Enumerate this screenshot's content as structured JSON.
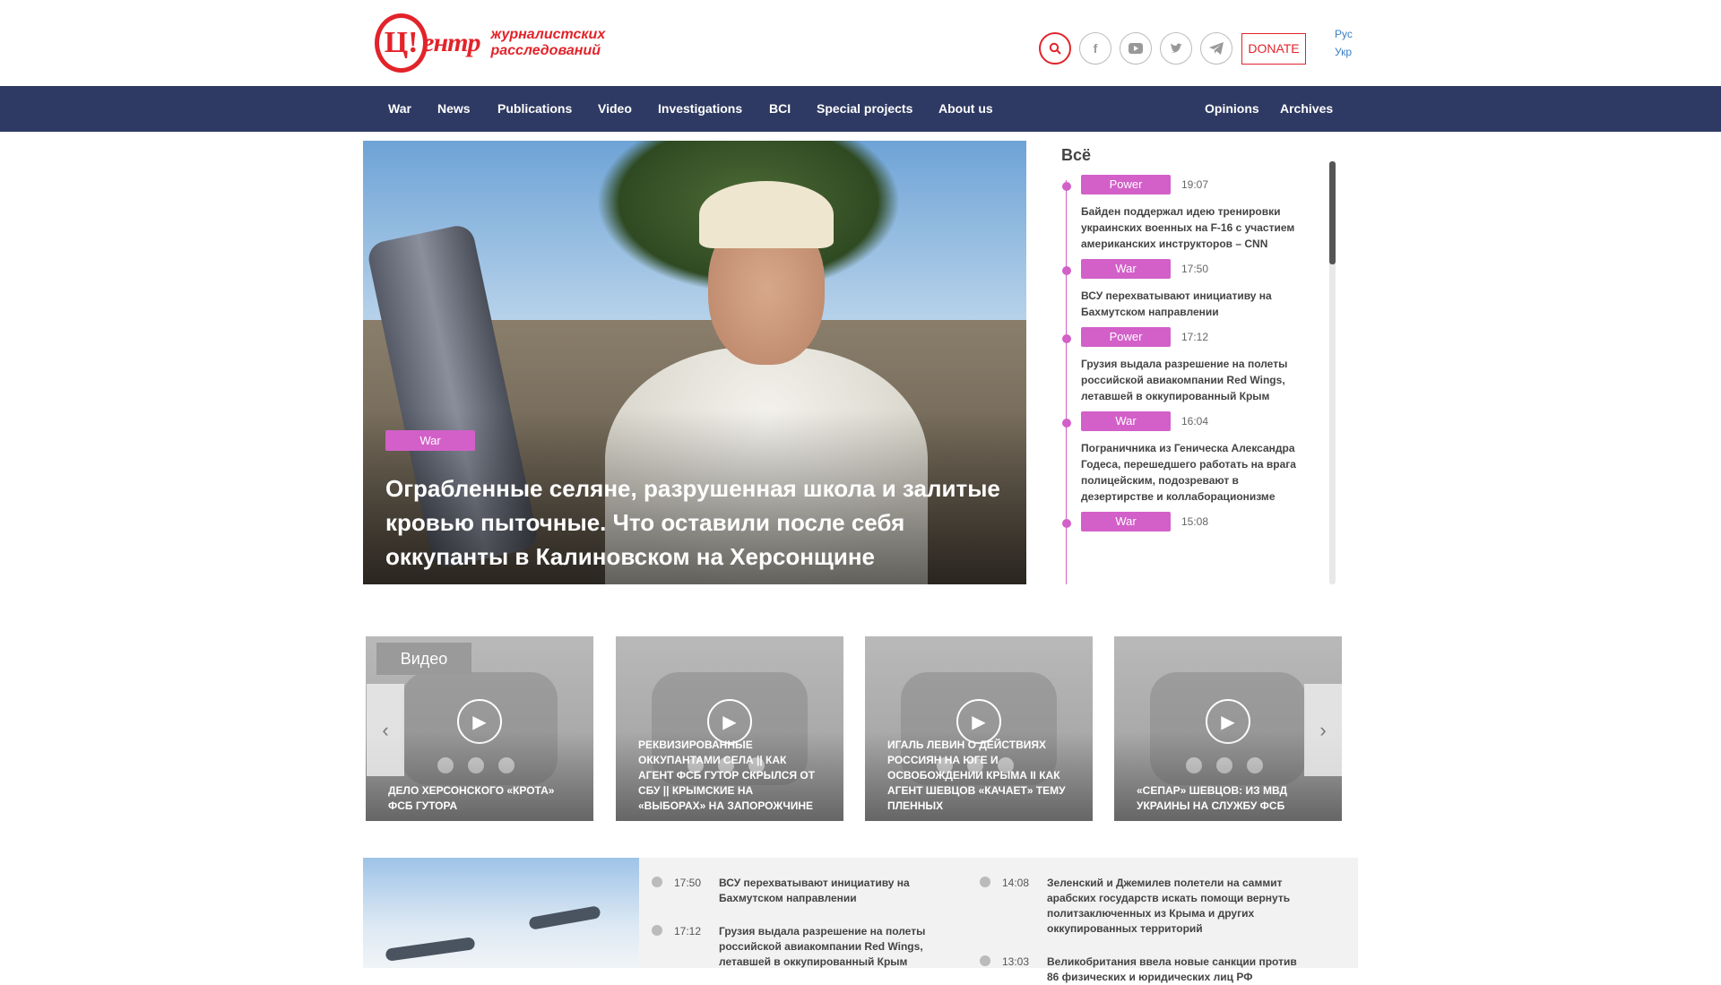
{
  "header": {
    "logo_mark": "Ц!",
    "logo_word": "ентр",
    "logo_sub": "журналистских расследований",
    "icons": [
      "search-icon",
      "facebook-icon",
      "youtube-icon",
      "twitter-icon",
      "telegram-icon"
    ],
    "donate_label": "DONATE",
    "languages": [
      "Рус",
      "Укр"
    ]
  },
  "nav": {
    "left": [
      "War",
      "News",
      "Publications",
      "Video",
      "Investigations",
      "BCI",
      "Special projects",
      "About us"
    ],
    "right": [
      "Opinions",
      "Archives"
    ]
  },
  "colors": {
    "brand_red": "#e2232a",
    "nav_bg": "#2e3a63",
    "tag": "#d260c8"
  },
  "hero": {
    "tag": "War",
    "title": "Ограбленные селяне, разрушенная школа и залитые кровью пыточные. Что оставили после себя оккупанты в Калиновском на Херсонщине"
  },
  "feed": {
    "title": "Всё",
    "items": [
      {
        "tag": "Power",
        "time": "19:07",
        "text": "Байден поддержал идею тренировки украинских военных на F-16 с участием американских инструкторов – CNN"
      },
      {
        "tag": "War",
        "time": "17:50",
        "text": "ВСУ перехватывают инициативу на Бахмутском направлении"
      },
      {
        "tag": "Power",
        "time": "17:12",
        "text": "Грузия выдала разрешение на полеты российской авиакомпании Red Wings, летавшей в оккупированный Крым"
      },
      {
        "tag": "War",
        "time": "16:04",
        "text": "Пограничника из Геническа Александра Годеса, перешедшего работать на врага полицейским, подозревают в дезертирстве и коллаборационизме"
      },
      {
        "tag": "War",
        "time": "15:08",
        "text": ""
      }
    ]
  },
  "videos": {
    "label": "Видео",
    "items": [
      {
        "title": "Дело херсонского «крота» ФСБ Гутора"
      },
      {
        "title": "Реквизированные оккупантами села || как агент ФСБ Гутор скрылся от СБУ || крымские на «выборах» на Запорожчине"
      },
      {
        "title": "Игаль Левин о действиях россиян на юге и освобождении Крыма II как агент Шевцов «качает» тему пленных"
      },
      {
        "title": "«Сепар» Шевцов: из МВД Украины на службу ФСБ"
      }
    ]
  },
  "bottom": {
    "col1": [
      {
        "time": "17:50",
        "text": "ВСУ перехватывают инициативу на Бахмутском направлении"
      },
      {
        "time": "17:12",
        "text": "Грузия выдала разрешение на полеты российской авиакомпании Red Wings, летавшей в оккупированный Крым"
      }
    ],
    "col2": [
      {
        "time": "14:08",
        "text": "Зеленский и Джемилев полетели на саммит арабских государств искать помощи вернуть политзаключенных из Крыма и других оккупированных территорий"
      },
      {
        "time": "13:03",
        "text": "Великобритания ввела новые санкции против 86 физических и юридических лиц РФ"
      }
    ]
  }
}
